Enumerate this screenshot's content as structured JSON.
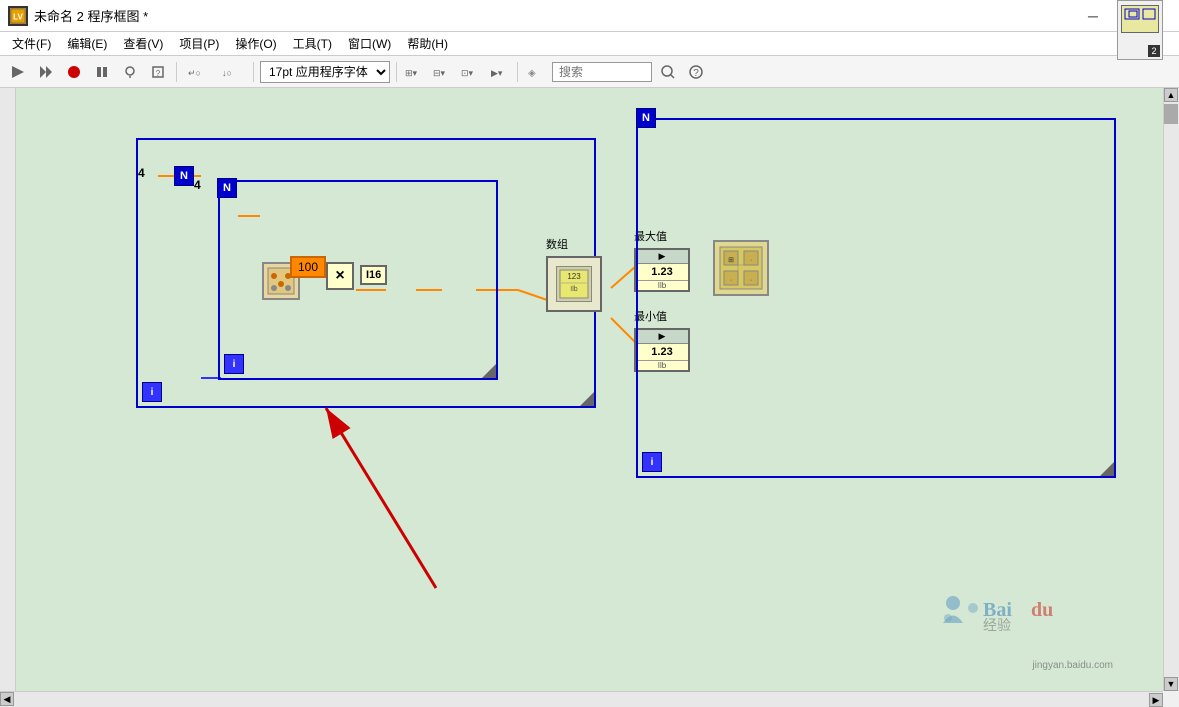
{
  "titleBar": {
    "icon": "LV",
    "title": "未命名 2 程序框图 *",
    "minimize": "─",
    "maximize": "□",
    "close": "✕"
  },
  "menuBar": {
    "items": [
      {
        "label": "文件(F)"
      },
      {
        "label": "编辑(E)"
      },
      {
        "label": "查看(V)"
      },
      {
        "label": "项目(P)"
      },
      {
        "label": "操作(O)"
      },
      {
        "label": "工具(T)"
      },
      {
        "label": "窗口(W)"
      },
      {
        "label": "帮助(H)"
      }
    ]
  },
  "toolbar": {
    "fontSelector": "17pt 应用程序字体",
    "searchPlaceholder": "搜索"
  },
  "canvas": {
    "outerLoopN": "N",
    "outerLoopI": "i",
    "innerLoopN": "N",
    "innerLoopI": "i",
    "outerCount": "4",
    "innerCount": "4",
    "numConst": "100",
    "typeLabel": "I16",
    "arrayLabel": "数组",
    "maxLabel": "最大值",
    "minLabel": "最小值",
    "indicatorVal": "1.23",
    "indicatorBottom": "Ilb"
  },
  "watermark": {
    "brand": "Baidu经验",
    "url": "jingyan.baidu.com"
  },
  "colors": {
    "loopBorder": "#0000cc",
    "wireColor": "#ff8800",
    "background": "#d4e8d4",
    "nodeYellow": "#ffffcc",
    "clusterColor": "#e0d890"
  }
}
